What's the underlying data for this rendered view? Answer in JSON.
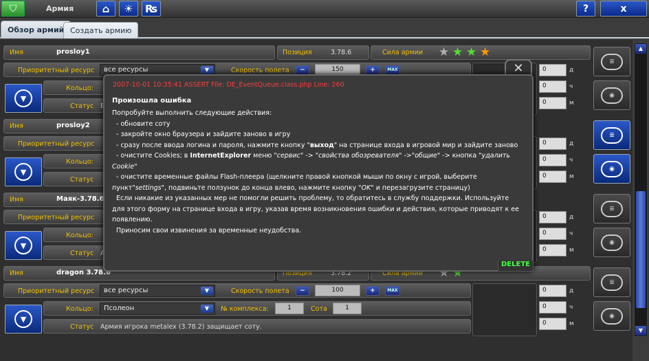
{
  "app": {
    "title": "Армия",
    "logo_icon": "shield-icon",
    "help_label": "?",
    "close_label": "x"
  },
  "tabs": [
    {
      "label": "Обзор армий"
    },
    {
      "label": "Создать армию"
    }
  ],
  "labels": {
    "name": "Имя",
    "position": "Позиция",
    "power": "Сила армии",
    "priority": "Приоритетный ресурс",
    "speed": "Скорость полета",
    "ring": "Кольцо:",
    "status": "Статус",
    "complex": "№ комплекса:",
    "sota": "Сота",
    "max": "MAX",
    "minus": "−",
    "plus": "+",
    "days": "д",
    "hours": "ч",
    "minutes": "м"
  },
  "armies": [
    {
      "name": "prosloy1",
      "position": "3.78.6",
      "stars": [
        "#b0b0b0",
        "#55dd33",
        "#55dd33",
        "#ff9900"
      ],
      "resource": "все ресурсы",
      "speed": "150",
      "ring": "",
      "status": "В",
      "timer": [
        "0",
        "0",
        "0"
      ]
    },
    {
      "name": "prosloy2",
      "position": "",
      "stars": [],
      "resource": "",
      "speed": "",
      "ring": "",
      "status": "",
      "timer": [
        "0",
        "0",
        "0"
      ]
    },
    {
      "name": "Маяк-3.78.6",
      "position": "",
      "stars": [],
      "resource": "",
      "speed": "",
      "ring": "",
      "status": "А",
      "timer": [
        "0",
        "0",
        "0"
      ]
    },
    {
      "name": "dragon 3.78.6",
      "position": "3.78.2",
      "stars": [
        "#b0b0b0",
        "#55dd33"
      ],
      "resource": "все ресурсы",
      "speed": "100",
      "ring": "Псолеон",
      "complex": "1",
      "sota": "1",
      "status": "Армия игрока metalex (3.78.2) защищает соту.",
      "timer": [
        "0",
        "0",
        "0"
      ]
    }
  ],
  "dialog": {
    "error_code": "2007-10-01 10:35:41  ASSERT File: DE_EventQueue.class.php Line: 260",
    "title": "Произошла ошибка",
    "intro": "Попробуйте выполнить следующие действия:",
    "step1": "- обновите соту",
    "step2": "- закройте окно браузера и зайдите заново в игру",
    "step3_pre": "- сразу после ввода логина и пароля, нажмите кнопку \"",
    "step3_bold": "выход",
    "step3_post": "\" на странице входа в игровой мир и зайдите заново",
    "step4_pre": "- очистите Cookies; в ",
    "step4_bold": "InternetExplorer",
    "step4_mid": " меню \"",
    "step4_i1": "сервис",
    "step4_a1": "\" -> \"",
    "step4_i2": "свойства обозревателя",
    "step4_a2": "\" ->\"",
    "step4_i3": "общие",
    "step4_a3": "\" -> кнопка \"",
    "step4_i4": "удалить",
    "step4_line2_i": "Cookie",
    "step4_line2_post": "\"",
    "step5": "- очистите временные файлы Flash-плеера (щелкните правой кнопкой мыши по окну с игрой, выберите",
    "step5_line2_pre": "пункт\"",
    "step5_line2_i": "settings",
    "step5_line2_post": "\", подвиньте ползунок до конца влево, нажмите кнопку \"",
    "step5_line2_i2": "OK",
    "step5_line2_end": "\" и перезагрузите страницу)",
    "support1": "Если никакие из указанных мер не помогли решить проблему, то обратитесь в службу поддержки. Используйте",
    "support2": "для этого форму на странице входа в игру, указав время возникновения ошибки и действия, которые приводят к ее",
    "support3": "появлению.",
    "apology": "Приносим свои извинения за временные неудобства.",
    "delete_label": "DELETE",
    "close_icon": "close-x-icon"
  }
}
